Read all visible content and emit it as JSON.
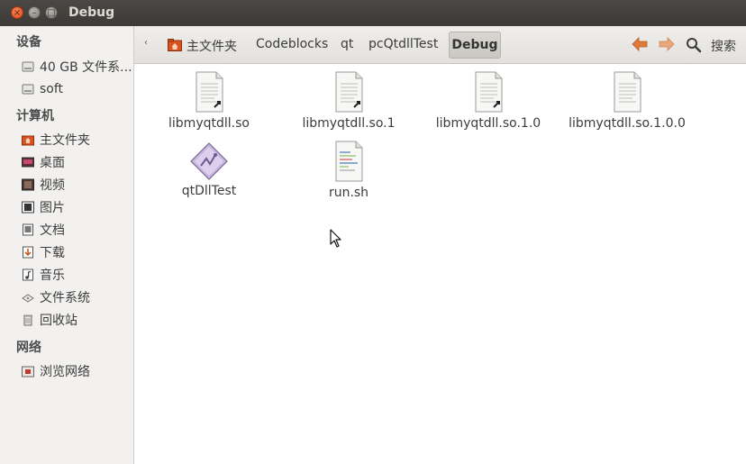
{
  "window": {
    "title": "Debug",
    "close_glyph": "×",
    "min_glyph": "–",
    "max_glyph": "□"
  },
  "sidebar": {
    "sections": [
      {
        "heading": "设备",
        "items": [
          {
            "label": "40 GB 文件系...",
            "icon": "drive-icon"
          },
          {
            "label": "soft",
            "icon": "drive-icon"
          }
        ]
      },
      {
        "heading": "计算机",
        "items": [
          {
            "label": "主文件夹",
            "icon": "home-folder-icon"
          },
          {
            "label": "桌面",
            "icon": "desktop-icon"
          },
          {
            "label": "视频",
            "icon": "videos-icon"
          },
          {
            "label": "图片",
            "icon": "pictures-icon"
          },
          {
            "label": "文档",
            "icon": "documents-icon"
          },
          {
            "label": "下载",
            "icon": "downloads-icon"
          },
          {
            "label": "音乐",
            "icon": "music-icon"
          },
          {
            "label": "文件系统",
            "icon": "filesystem-icon"
          },
          {
            "label": "回收站",
            "icon": "trash-icon"
          }
        ]
      },
      {
        "heading": "网络",
        "items": [
          {
            "label": "浏览网络",
            "icon": "network-icon"
          }
        ]
      }
    ]
  },
  "toolbar": {
    "back_glyph": "‹",
    "breadcrumbs": [
      "主文件夹",
      "Codeblocks",
      "qt",
      "pcQtdllTest"
    ],
    "current": "Debug",
    "back_arrow": "🡐",
    "forward_arrow": "🡒",
    "search_label": "搜索"
  },
  "files": [
    {
      "name": "libmyqtdll.so",
      "type": "shared-library"
    },
    {
      "name": "libmyqtdll.so.1",
      "type": "shared-library-link"
    },
    {
      "name": "libmyqtdll.so.1.0",
      "type": "shared-library-link"
    },
    {
      "name": "libmyqtdll.so.1.0.0",
      "type": "shared-library"
    },
    {
      "name": "qtDllTest",
      "type": "executable"
    },
    {
      "name": "run.sh",
      "type": "shell-script"
    }
  ],
  "colors": {
    "titlebar": "#3c3b37",
    "sidebar": "#f2f1ef",
    "accent_orange": "#e07a3a",
    "home_icon": "#d9531e"
  }
}
